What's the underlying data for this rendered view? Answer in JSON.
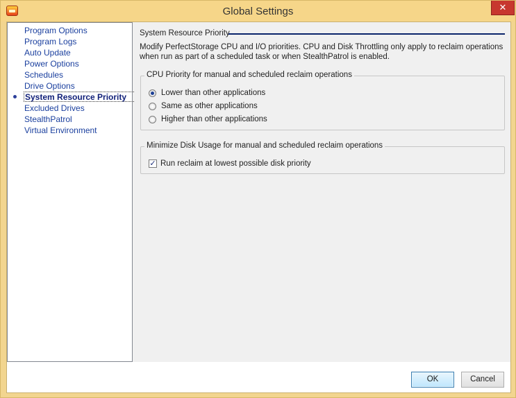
{
  "window": {
    "title": "Global Settings",
    "close_label": "✕"
  },
  "nav": {
    "items": [
      {
        "label": "Program Options",
        "selected": false
      },
      {
        "label": "Program Logs",
        "selected": false
      },
      {
        "label": "Auto Update",
        "selected": false
      },
      {
        "label": "Power Options",
        "selected": false
      },
      {
        "label": "Schedules",
        "selected": false
      },
      {
        "label": "Drive Options",
        "selected": false
      },
      {
        "label": "System Resource Priority",
        "selected": true
      },
      {
        "label": "Excluded Drives",
        "selected": false
      },
      {
        "label": "StealthPatrol",
        "selected": false
      },
      {
        "label": "Virtual Environment",
        "selected": false
      }
    ]
  },
  "content": {
    "section_title": "System Resource Priority",
    "description": "Modify PerfectStorage CPU and I/O priorities. CPU and Disk Throttling only apply to reclaim operations when run as part of a scheduled task or when StealthPatrol is enabled.",
    "cpu_group": {
      "label": "CPU Priority for manual and scheduled reclaim operations",
      "options": [
        {
          "label": "Lower than other applications",
          "checked": true
        },
        {
          "label": "Same as other applications",
          "checked": false
        },
        {
          "label": "Higher than other applications",
          "checked": false
        }
      ]
    },
    "disk_group": {
      "label": "Minimize Disk Usage for manual and scheduled reclaim operations",
      "checkbox": {
        "label": "Run reclaim at lowest possible disk priority",
        "checked": true
      }
    }
  },
  "footer": {
    "ok_label": "OK",
    "cancel_label": "Cancel"
  },
  "colors": {
    "title_bar": "#f6d689",
    "nav_link": "#1a3f9e",
    "section_rule": "#0a246a",
    "close_button": "#c7372f"
  }
}
